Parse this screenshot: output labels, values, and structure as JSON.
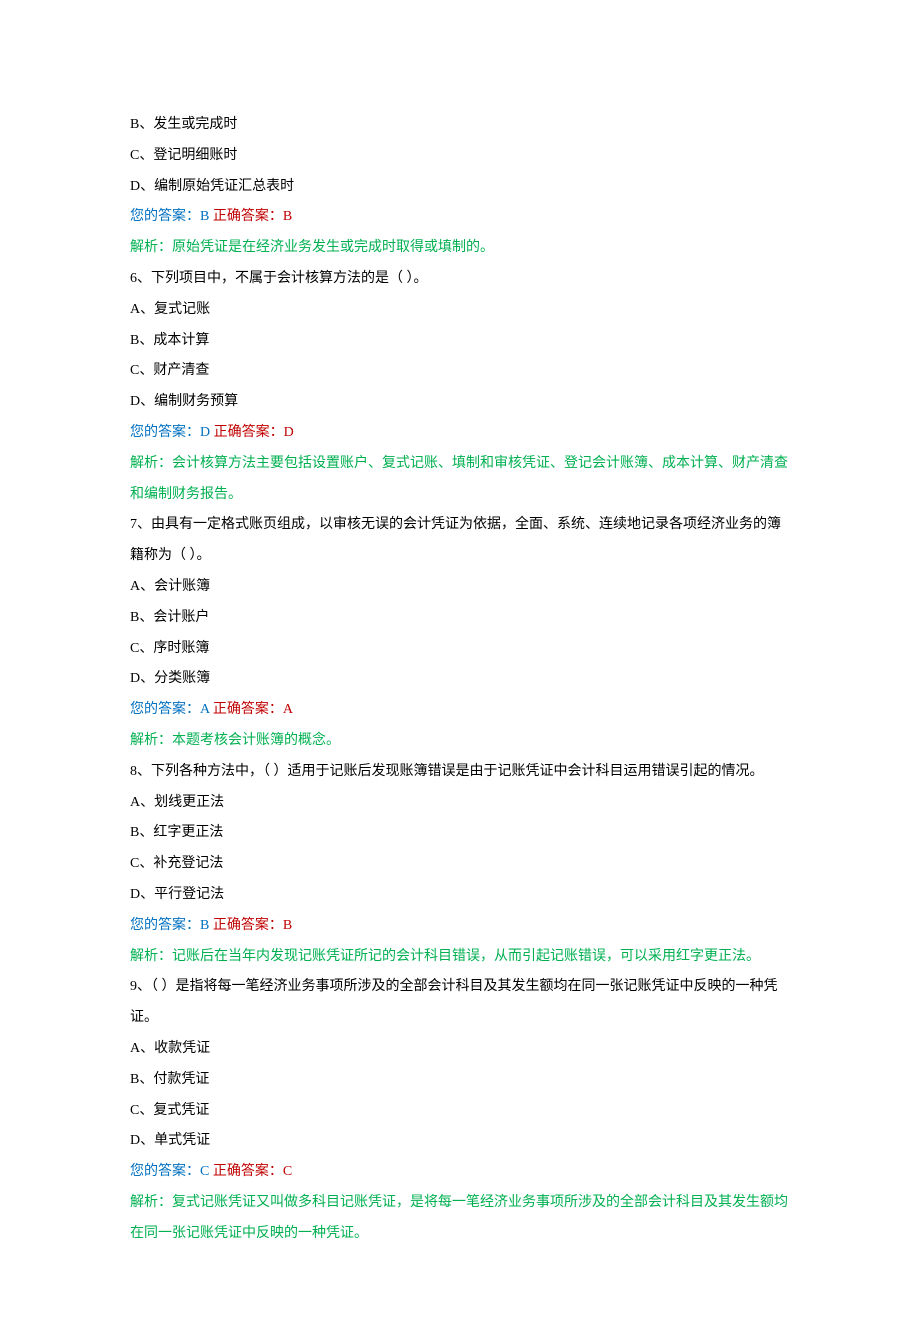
{
  "q5_partial": {
    "options": {
      "b": "B、发生或完成时",
      "c": "C、登记明细账时",
      "d": "D、编制原始凭证汇总表时"
    },
    "ans_user_label": "您的答案：",
    "ans_user_val": "B",
    "ans_correct_label": " 正确答案：",
    "ans_correct_val": "B",
    "explain_label": "解析：",
    "explain_body": "原始凭证是在经济业务发生或完成时取得或填制的。"
  },
  "q6": {
    "stem": "6、下列项目中，不属于会计核算方法的是（ ）。",
    "options": {
      "a": "A、复式记账",
      "b": "B、成本计算",
      "c": "C、财产清查",
      "d": "D、编制财务预算"
    },
    "ans_user_label": "您的答案：",
    "ans_user_val": "D",
    "ans_correct_label": " 正确答案：",
    "ans_correct_val": "D",
    "explain_label": "解析：",
    "explain_body": "会计核算方法主要包括设置账户、复式记账、填制和审核凭证、登记会计账簿、成本计算、财产清查和编制财务报告。"
  },
  "q7": {
    "stem": "7、由具有一定格式账页组成，以审核无误的会计凭证为依据，全面、系统、连续地记录各项经济业务的簿籍称为（ ）。",
    "options": {
      "a": "A、会计账簿",
      "b": "B、会计账户",
      "c": "C、序时账簿",
      "d": "D、分类账簿"
    },
    "ans_user_label": "您的答案：",
    "ans_user_val": "A",
    "ans_correct_label": " 正确答案：",
    "ans_correct_val": "A",
    "explain_label": "解析：",
    "explain_body": "本题考核会计账簿的概念。"
  },
  "q8": {
    "stem": "8、下列各种方法中，（ ）适用于记账后发现账簿错误是由于记账凭证中会计科目运用错误引起的情况。",
    "options": {
      "a": "A、划线更正法",
      "b": "B、红字更正法",
      "c": "C、补充登记法",
      "d": "D、平行登记法"
    },
    "ans_user_label": "您的答案：",
    "ans_user_val": "B",
    "ans_correct_label": " 正确答案：",
    "ans_correct_val": "B",
    "explain_label": "解析：",
    "explain_body": "记账后在当年内发现记账凭证所记的会计科目错误，从而引起记账错误，可以采用红字更正法。"
  },
  "q9": {
    "stem": "9、（ ）是指将每一笔经济业务事项所涉及的全部会计科目及其发生额均在同一张记账凭证中反映的一种凭证。",
    "options": {
      "a": "A、收款凭证",
      "b": "B、付款凭证",
      "c": "C、复式凭证",
      "d": "D、单式凭证"
    },
    "ans_user_label": "您的答案：",
    "ans_user_val": "C",
    "ans_correct_label": " 正确答案：",
    "ans_correct_val": "C",
    "explain_label": "解析：",
    "explain_body": "复式记账凭证又叫做多科目记账凭证，是将每一笔经济业务事项所涉及的全部会计科目及其发生额均在同一张记账凭证中反映的一种凭证。"
  }
}
